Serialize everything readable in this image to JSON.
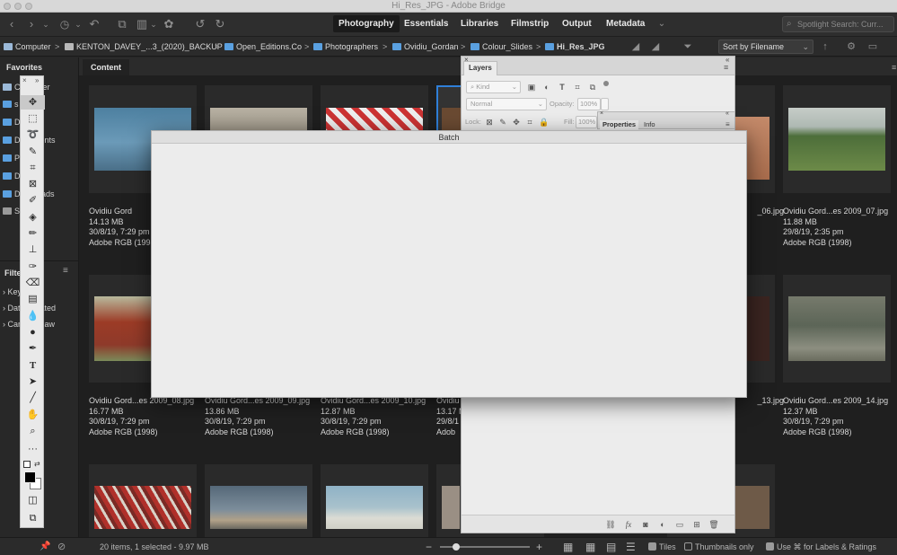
{
  "window": {
    "title": "Hi_Res_JPG - Adobe Bridge"
  },
  "workspaces": {
    "tabs": [
      "Photography",
      "Essentials",
      "Libraries",
      "Filmstrip",
      "Output",
      "Metadata"
    ],
    "active": "Photography",
    "more_icon": "chevron-down-icon"
  },
  "search": {
    "placeholder": "Spotlight Search: Curr..."
  },
  "path": {
    "crumbs": [
      "Computer",
      "KENTON_DAVEY_...3_(2020)_BACKUP",
      "Open_Editions.Co",
      "Photographers",
      "Ovidiu_Gordan",
      "Colour_Slides",
      "Hi_Res_JPG"
    ]
  },
  "sort": {
    "label": "Sort by Filename"
  },
  "left_panel": {
    "favorites_title": "Favorites",
    "favorites": [
      "Computer",
      "s",
      "D",
      "Documents",
      "P",
      "D",
      "Downloads",
      "S"
    ],
    "filter_title": "Filte",
    "filters": [
      "Key",
      "Date Created",
      "Camera Raw"
    ]
  },
  "content": {
    "tab_label": "Content",
    "tiles": [
      {
        "name": "Ovidiu Gord",
        "size": "14.13 MB",
        "date": "30/8/19, 7:29 pm",
        "profile": "Adobe RGB (1998"
      },
      {
        "name": "",
        "size": "",
        "date": "",
        "profile": ""
      },
      {
        "name": "",
        "size": "",
        "date": "",
        "profile": ""
      },
      {
        "name": "",
        "size": "",
        "date": "",
        "profile": ""
      },
      {
        "name": "_06.jpg",
        "size": "",
        "date": "",
        "profile": ""
      },
      {
        "name": "Ovidiu Gord...es 2009_07.jpg",
        "size": "11.88 MB",
        "date": "29/8/19, 2:35 pm",
        "profile": "Adobe RGB (1998)"
      },
      {
        "name": "Ovidiu Gord...es 2009_08.jpg",
        "size": "16.77 MB",
        "date": "30/8/19, 7:29 pm",
        "profile": "Adobe RGB (1998)"
      },
      {
        "name": "Ovidiu Gord...es 2009_09.jpg",
        "size": "13.86 MB",
        "date": "30/8/19, 7:29 pm",
        "profile": "Adobe RGB (1998)"
      },
      {
        "name": "Ovidiu Gord...es 2009_10.jpg",
        "size": "12.87 MB",
        "date": "30/8/19, 7:29 pm",
        "profile": "Adobe RGB (1998)"
      },
      {
        "name": "Ovidiu",
        "size": "13.17 M",
        "date": "29/8/1",
        "profile": "Adob"
      },
      {
        "name": "_13.jpg",
        "size": "",
        "date": "",
        "profile": ""
      },
      {
        "name": "Ovidiu Gord...es 2009_14.jpg",
        "size": "12.37 MB",
        "date": "30/8/19, 7:29 pm",
        "profile": "Adobe RGB (1998)"
      }
    ]
  },
  "status": {
    "summary": "20 items, 1 selected - 9.97 MB",
    "tiles_label": "Tiles",
    "thumbs_only_label": "Thumbnails only",
    "labels_label": "Use ⌘ for Labels & Ratings"
  },
  "layers_panel": {
    "tab": "Layers",
    "kind": "Kind",
    "blend_mode": "Normal",
    "opacity_label": "Opacity:",
    "opacity_value": "100%",
    "lock_label": "Lock:",
    "fill_label": "Fill:",
    "fill_value": "100%"
  },
  "properties_panel": {
    "tabs": [
      "Properties",
      "Info"
    ]
  },
  "batch_dialog": {
    "title": "Batch"
  },
  "colors": {
    "accent": "#2f7fd8",
    "app_bg": "#1f1f1f",
    "panel_light": "#ececec"
  }
}
